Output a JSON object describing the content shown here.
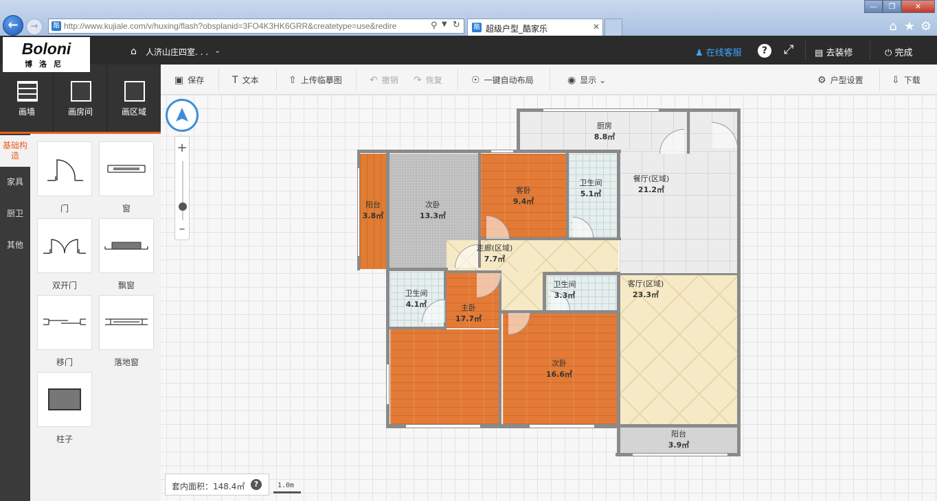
{
  "browser": {
    "url": "http://www.kujiale.com/v/huxing/flash?obsplanid=3FO4K3HK6GRR&createtype=use&redire",
    "tab_title": "超级户型_酷家乐"
  },
  "header": {
    "logo_main": "Boloni",
    "logo_sub": "博洛尼",
    "project_name": "人济山庄四室. . .",
    "online_service": "在线客服",
    "renovate": "去装修",
    "done": "完成"
  },
  "tools": [
    {
      "label": "画墙"
    },
    {
      "label": "画房间"
    },
    {
      "label": "画区域"
    }
  ],
  "categories": [
    {
      "label": "基础构造"
    },
    {
      "label": "家具"
    },
    {
      "label": "厨卫"
    },
    {
      "label": "其他"
    }
  ],
  "components": [
    {
      "label": "门"
    },
    {
      "label": "窗"
    },
    {
      "label": "双开门"
    },
    {
      "label": "飘窗"
    },
    {
      "label": "移门"
    },
    {
      "label": "落地窗"
    },
    {
      "label": "柱子"
    }
  ],
  "toolbar": {
    "save": "保存",
    "text": "文本",
    "upload_sketch": "上传临摹图",
    "undo": "撤销",
    "redo": "恢复",
    "auto_layout": "一键自动布局",
    "display": "显示",
    "floorplan_settings": "户型设置",
    "download": "下载"
  },
  "rooms": [
    {
      "name": "厨房",
      "area": "8.8㎡"
    },
    {
      "name": "阳台",
      "area": "3.8㎡"
    },
    {
      "name": "次卧",
      "area": "13.3㎡"
    },
    {
      "name": "客卧",
      "area": "9.4㎡"
    },
    {
      "name": "卫生间",
      "area": "5.1㎡"
    },
    {
      "name": "餐厅(区域)",
      "area": "21.2㎡"
    },
    {
      "name": "走廊(区域)",
      "area": "7.7㎡"
    },
    {
      "name": "卫生间",
      "area": "4.1㎡"
    },
    {
      "name": "主卧",
      "area": "17.7㎡"
    },
    {
      "name": "卫生间",
      "area": "3.3㎡"
    },
    {
      "name": "客厅(区域)",
      "area": "23.3㎡"
    },
    {
      "name": "次卧",
      "area": "16.6㎡"
    },
    {
      "name": "阳台",
      "area": "3.9㎡"
    }
  ],
  "footer": {
    "area_text": "套内面积：148.4㎡",
    "scale": "1.0m"
  },
  "icons": {
    "back": "back-arrow-icon",
    "home": "home-icon",
    "service": "people-icon",
    "help": "help-icon",
    "fullscreen": "fullscreen-icon",
    "renovate": "paint-roller-icon",
    "power": "power-icon",
    "compass": "compass-icon"
  },
  "colors": {
    "accent": "#e8601c",
    "header_bg": "#2b2b2b",
    "link_blue": "#3aa5ff"
  }
}
